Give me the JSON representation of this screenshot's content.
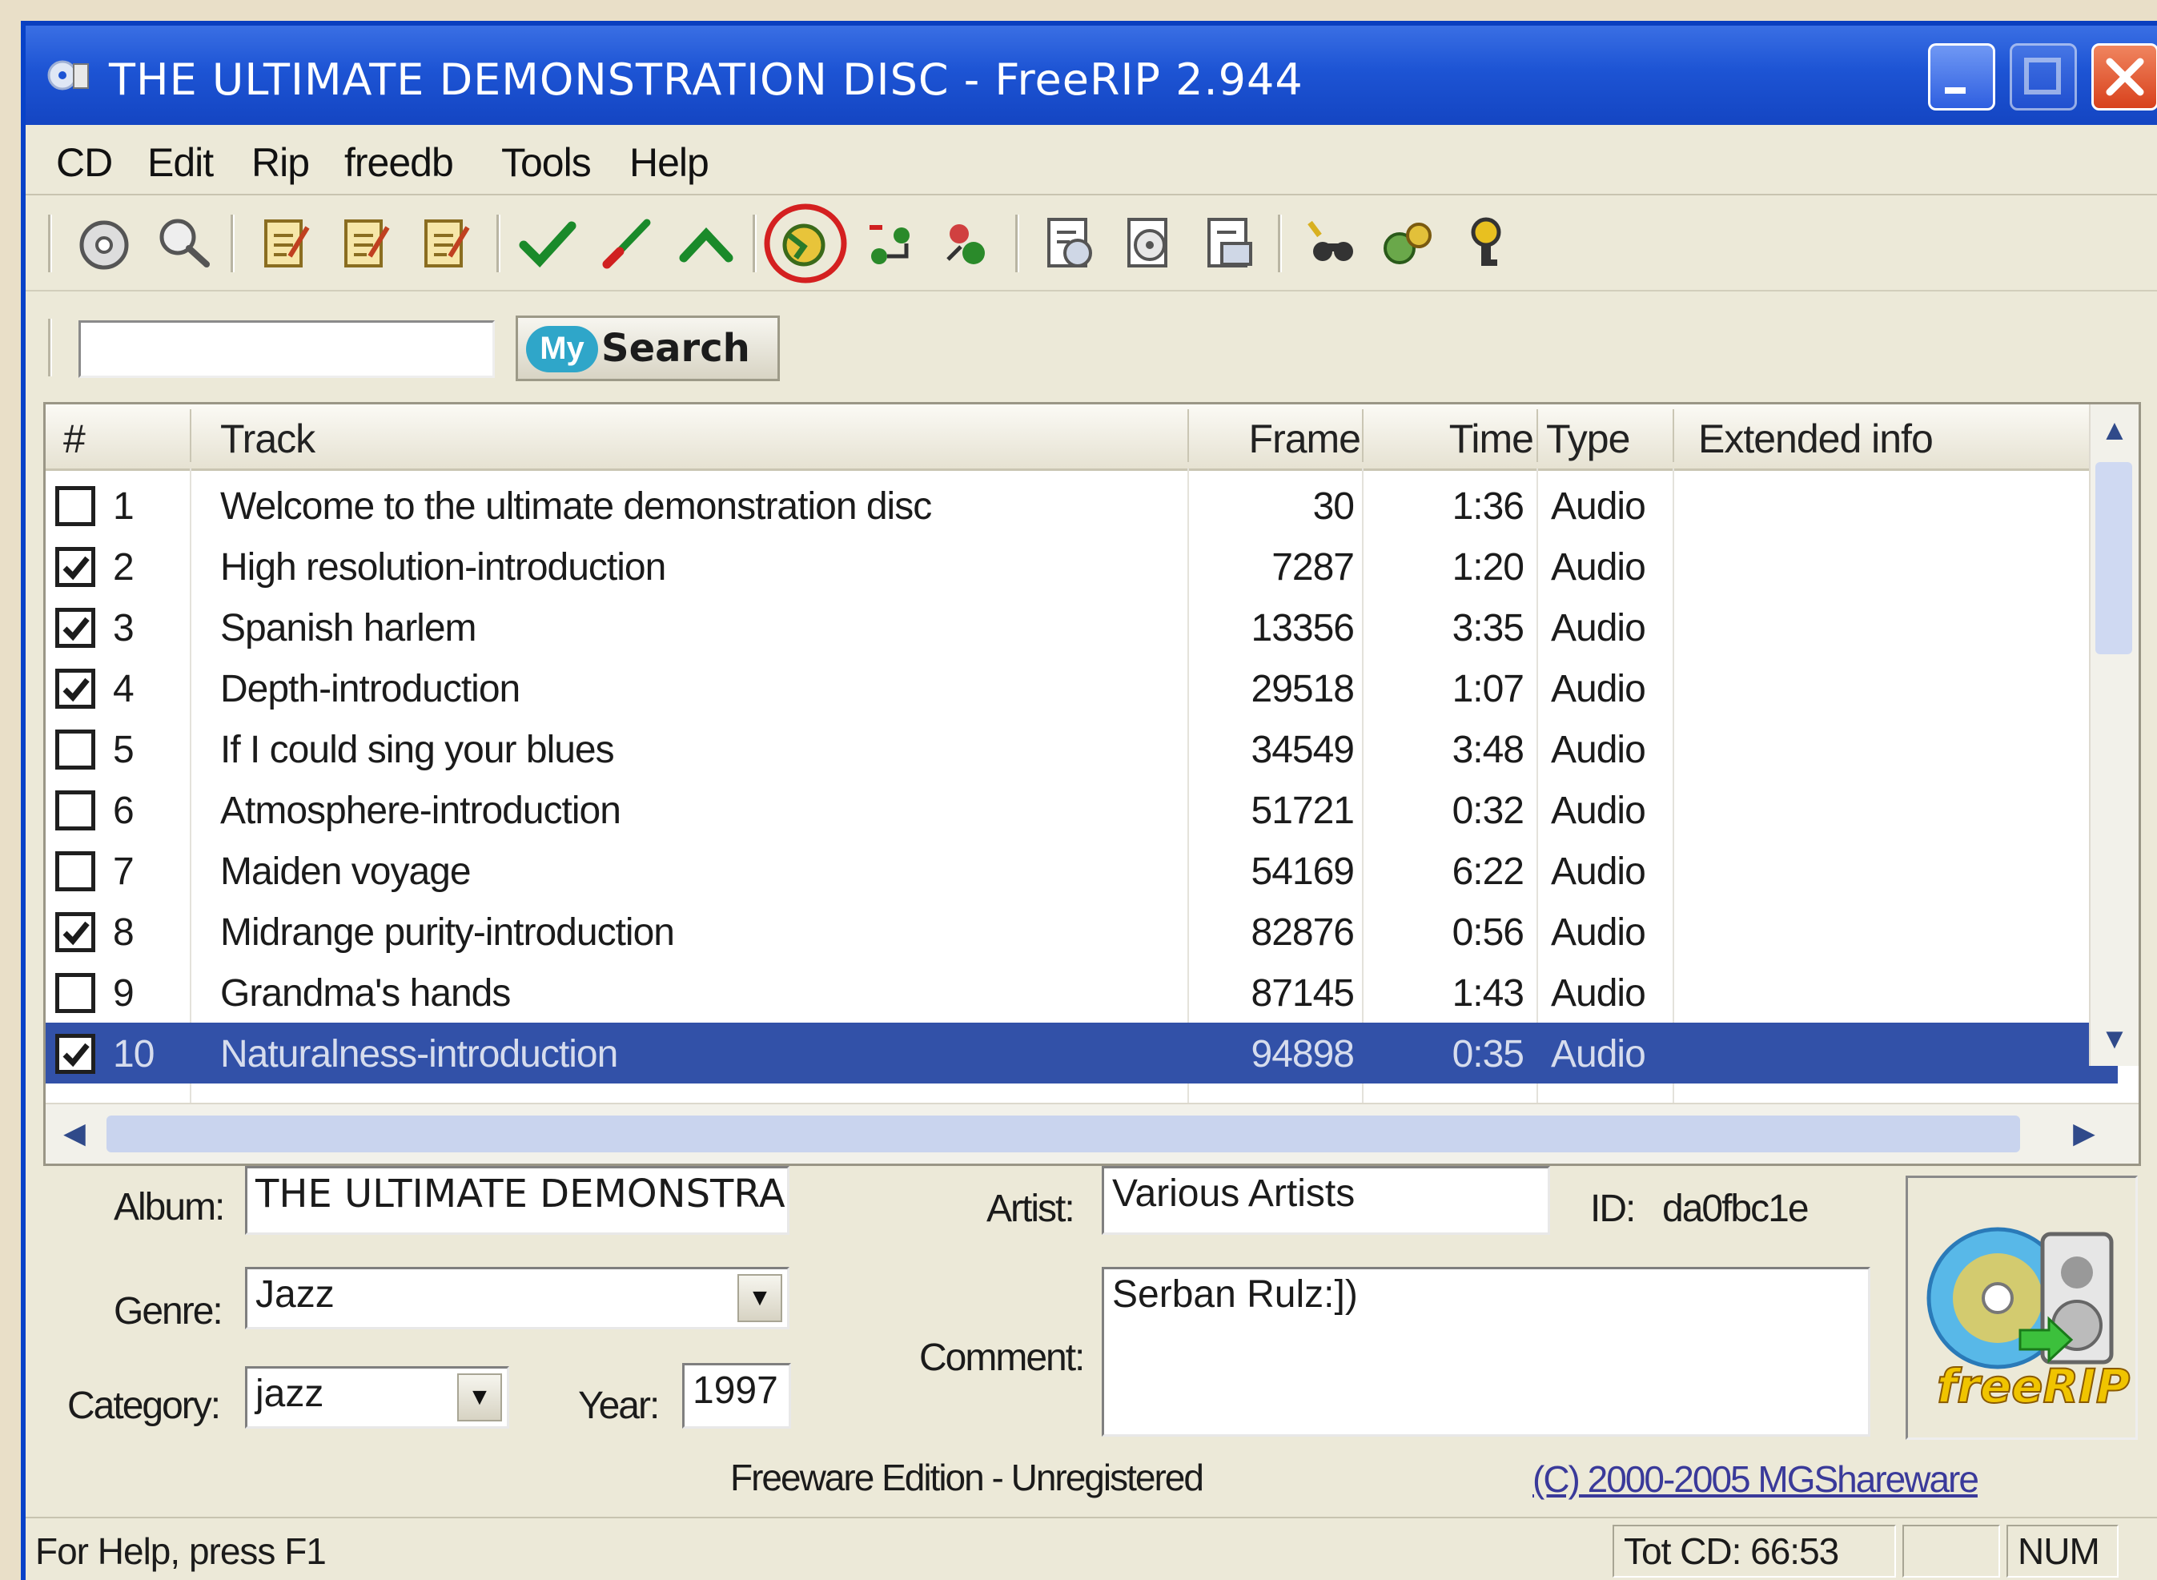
{
  "window": {
    "title": "THE ULTIMATE DEMONSTRATION DISC - FreeRIP 2.944"
  },
  "menu": [
    "CD",
    "Edit",
    "Rip",
    "freedb",
    "Tools",
    "Help"
  ],
  "toolbar": {
    "icons": [
      "cd-play-icon",
      "cd-search-icon",
      "edit-tags-icon",
      "edit-tags-icon",
      "edit-tags-icon",
      "check-all-icon",
      "uncheck-icon",
      "invert-check-icon",
      "rip-icon",
      "convert-icon",
      "convert-icon",
      "report-icon",
      "report-icon",
      "report-icon",
      "lookup-icon",
      "settings-icon",
      "help-icon"
    ],
    "highlighted": "rip-icon",
    "highlight_color": "#d42020"
  },
  "search": {
    "value": "",
    "button_prefix": "My",
    "button_word": "Search"
  },
  "table": {
    "columns": [
      "#",
      "Track",
      "Frame",
      "Time",
      "Type",
      "Extended info"
    ],
    "rows": [
      {
        "checked": false,
        "num": "1",
        "track": "Welcome to the ultimate demonstration disc",
        "frame": "30",
        "time": "1:36",
        "type": "Audio",
        "extended": ""
      },
      {
        "checked": true,
        "num": "2",
        "track": "High resolution-introduction",
        "frame": "7287",
        "time": "1:20",
        "type": "Audio",
        "extended": ""
      },
      {
        "checked": true,
        "num": "3",
        "track": "Spanish harlem",
        "frame": "13356",
        "time": "3:35",
        "type": "Audio",
        "extended": ""
      },
      {
        "checked": true,
        "num": "4",
        "track": "Depth-introduction",
        "frame": "29518",
        "time": "1:07",
        "type": "Audio",
        "extended": ""
      },
      {
        "checked": false,
        "num": "5",
        "track": "If I could sing your blues",
        "frame": "34549",
        "time": "3:48",
        "type": "Audio",
        "extended": ""
      },
      {
        "checked": false,
        "num": "6",
        "track": "Atmosphere-introduction",
        "frame": "51721",
        "time": "0:32",
        "type": "Audio",
        "extended": ""
      },
      {
        "checked": false,
        "num": "7",
        "track": "Maiden voyage",
        "frame": "54169",
        "time": "6:22",
        "type": "Audio",
        "extended": ""
      },
      {
        "checked": true,
        "num": "8",
        "track": "Midrange purity-introduction",
        "frame": "82876",
        "time": "0:56",
        "type": "Audio",
        "extended": ""
      },
      {
        "checked": false,
        "num": "9",
        "track": "Grandma's hands",
        "frame": "87145",
        "time": "1:43",
        "type": "Audio",
        "extended": ""
      },
      {
        "checked": true,
        "num": "10",
        "track": "Naturalness-introduction",
        "frame": "94898",
        "time": "0:35",
        "type": "Audio",
        "extended": "",
        "selected": true
      }
    ],
    "selection_color": "#3251a8"
  },
  "details": {
    "album_label": "Album:",
    "album_value": "THE ULTIMATE DEMONSTRA",
    "genre_label": "Genre:",
    "genre_value": "Jazz",
    "category_label": "Category:",
    "category_value": "jazz",
    "year_label": "Year:",
    "year_value": "1997",
    "artist_label": "Artist:",
    "artist_value": "Various Artists",
    "id_label": "ID:",
    "id_value": "da0fbc1e",
    "comment_label": "Comment:",
    "comment_value": "Serban Rulz:])",
    "edition": "Freeware Edition - Unregistered",
    "copyright_link": "(C) 2000-2005 MGShareware",
    "logo_text": "freeRIP"
  },
  "statusbar": {
    "help": "For Help, press F1",
    "total": "Tot CD: 66:53",
    "blank": "",
    "num": "NUM"
  }
}
